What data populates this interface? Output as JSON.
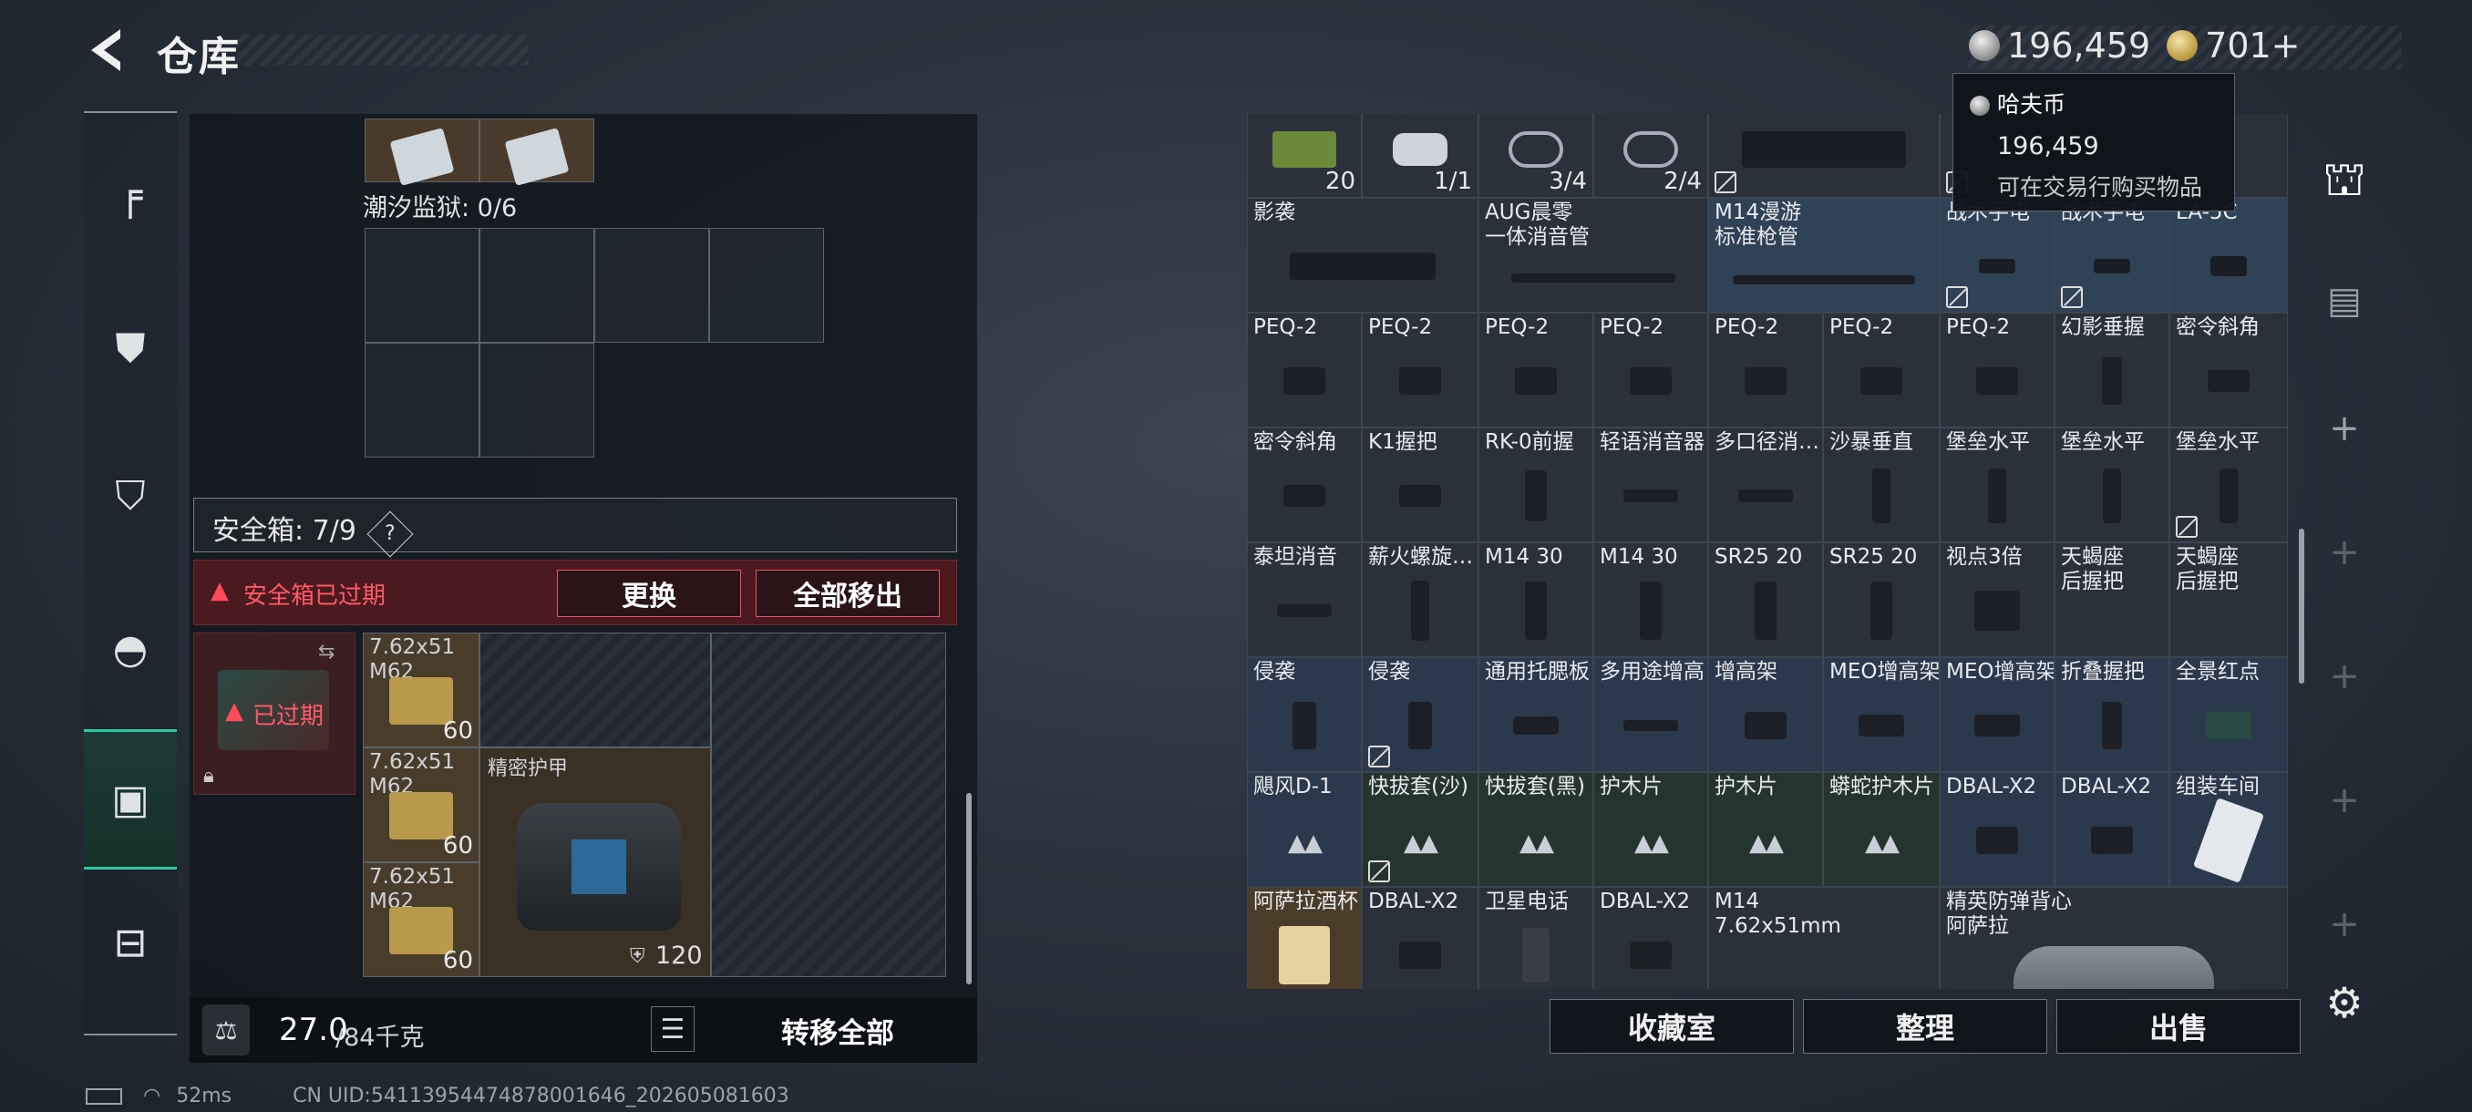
{
  "header": {
    "title": "仓库"
  },
  "currency": {
    "silver": "196,459",
    "gold": "701+"
  },
  "tooltip": {
    "title": "哈夫币",
    "value": "196,459",
    "desc": "可在交易行购买物品"
  },
  "left": {
    "prison_label": "潮汐监狱: 0/6",
    "safebox_label": "安全箱: 7/9",
    "safebox_help": "?",
    "expired_text": "安全箱已过期",
    "replace_btn": "更换",
    "remove_all_btn": "全部移出",
    "case_expired": "已过期",
    "ammo": [
      {
        "name": "7.62x51\nM62",
        "count": "60"
      },
      {
        "name": "7.62x51\nM62",
        "count": "60"
      },
      {
        "name": "7.62x51\nM62",
        "count": "60"
      }
    ],
    "armor_label": "精密护甲",
    "armor_value": "120",
    "weight_value": "27.0",
    "weight_max": "/84千克",
    "transfer_all": "转移全部"
  },
  "grid": {
    "row0": [
      {
        "label": "",
        "count": "20"
      },
      {
        "label": "",
        "count": "1/1"
      },
      {
        "label": "",
        "count": "3/4"
      },
      {
        "label": "",
        "count": "2/4"
      },
      {
        "label": "",
        "count": ""
      }
    ],
    "rows": [
      [
        "影袭",
        "AUG晨零\n一体消音管",
        "",
        "M14漫游\n标准枪管",
        "",
        "战术手电",
        "战术手电",
        "LA-5C"
      ],
      [
        "PEQ-2",
        "PEQ-2",
        "PEQ-2",
        "PEQ-2",
        "PEQ-2",
        "PEQ-2",
        "PEQ-2",
        "幻影垂握",
        "密令斜角"
      ],
      [
        "密令斜角",
        "K1握把",
        "RK-0前握",
        "轻语消音器",
        "多口径消…",
        "沙暴垂直",
        "堡垒水平",
        "堡垒水平",
        "堡垒水平"
      ],
      [
        "泰坦消音",
        "薪火螺旋…",
        "M14 30",
        "M14 30",
        "SR25 20",
        "SR25 20",
        "视点3倍",
        "天蝎座\n后握把",
        "天蝎座\n后握把"
      ],
      [
        "侵袭",
        "侵袭",
        "通用托腮板",
        "多用途增高",
        "增高架",
        "MEO增高架",
        "MEO增高架",
        "折叠握把",
        "全景红点"
      ],
      [
        "飓风D-1",
        "快拔套(沙)",
        "快拔套(黑)",
        "护木片",
        "护木片",
        "蟒蛇护木片",
        "DBAL-X2",
        "DBAL-X2",
        "组装车间"
      ],
      [
        "阿萨拉酒杯",
        "DBAL-X2",
        "卫星电话",
        "DBAL-X2",
        "M14\n7.62x51mm",
        "",
        "精英防弹背心\n阿萨拉"
      ]
    ]
  },
  "actions": {
    "collection": "收藏室",
    "organize": "整理",
    "sell": "出售"
  },
  "status": {
    "ping": "52ms",
    "uid": "CN UID:54113954474878001646_202605081603"
  }
}
